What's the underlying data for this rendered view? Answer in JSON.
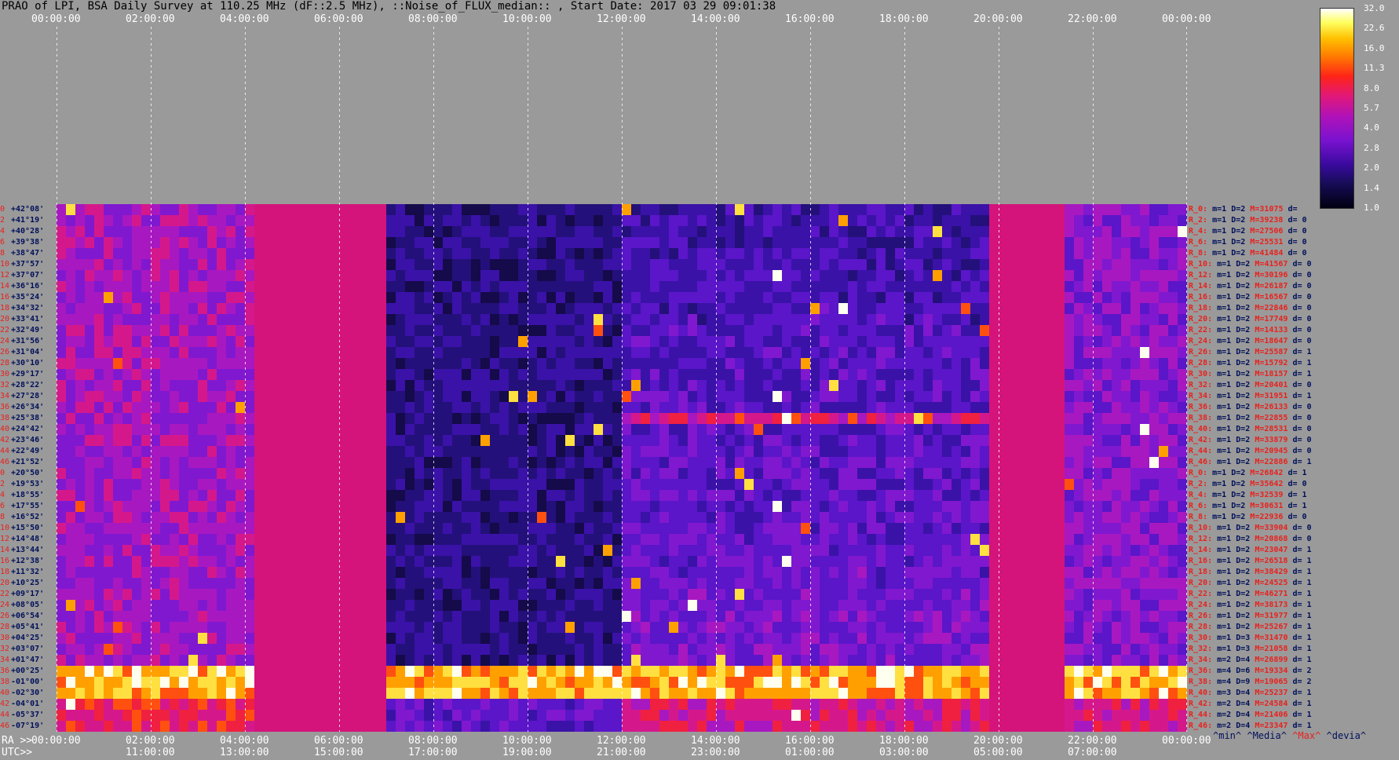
{
  "chart_data": {
    "type": "heatmap",
    "title": "PRAO of LPI, BSA Daily Survey at 110.25 MHz (dF::2.5 MHz), ::Noise_of_FLUX_median:: , Start Date: 2017 03 29 09:01:38",
    "top_ticks": [
      "00:00:00",
      "02:00:00",
      "04:00:00",
      "06:00:00",
      "08:00:00",
      "10:00:00",
      "12:00:00",
      "14:00:00",
      "16:00:00",
      "18:00:00",
      "20:00:00",
      "22:00:00",
      "00:00:00"
    ],
    "bottom_ra_label": "RA >>",
    "bottom_ra_ticks": [
      "00:00:00",
      "02:00:00",
      "04:00:00",
      "06:00:00",
      "08:00:00",
      "10:00:00",
      "12:00:00",
      "14:00:00",
      "16:00:00",
      "18:00:00",
      "20:00:00",
      "22:00:00",
      "00:00:00"
    ],
    "bottom_utc_label": "UTC>>",
    "bottom_utc_ticks": [
      "11:00:00",
      "13:00:00",
      "15:00:00",
      "17:00:00",
      "19:00:00",
      "21:00:00",
      "23:00:00",
      "01:00:00",
      "03:00:00",
      "05:00:00",
      "07:00:00"
    ],
    "colorbar_ticks": [
      "32.0",
      "22.6",
      "16.0",
      "11.3",
      "8.0",
      "5.7",
      "4.0",
      "2.8",
      "2.0",
      "1.4",
      "1.0"
    ],
    "declinations": [
      "+42°08'",
      "+41°19'",
      "+40°28'",
      "+39°38'",
      "+38°47'",
      "+37°57'",
      "+37°07'",
      "+36°16'",
      "+35°24'",
      "+34°32'",
      "+33°41'",
      "+32°49'",
      "+31°56'",
      "+31°04'",
      "+30°10'",
      "+29°17'",
      "+28°22'",
      "+27°28'",
      "+26°34'",
      "+25°38'",
      "+24°42'",
      "+23°46'",
      "+22°49'",
      "+21°52'",
      "+20°50'",
      "+19°53'",
      "+18°55'",
      "+17°55'",
      "+16°52'",
      "+15°50'",
      "+14°48'",
      "+13°44'",
      "+12°38'",
      "+11°32'",
      "+10°25'",
      "+09°17'",
      "+08°05'",
      "+06°54'",
      "+05°41'",
      "+04°25'",
      "+03°07'",
      "+01°47'",
      "+00°25'",
      "-01°00'",
      "-02°30'",
      "-04°01'",
      "-05°37'",
      "-07°19'"
    ],
    "beam_index": [
      "0",
      "2",
      "4",
      "6",
      "8",
      "10",
      "12",
      "14",
      "16",
      "18",
      "20",
      "22",
      "24",
      "26",
      "28",
      "30",
      "32",
      "34",
      "36",
      "38",
      "40",
      "42",
      "44",
      "46",
      "0",
      "2",
      "4",
      "6",
      "8",
      "10",
      "12",
      "14",
      "16",
      "18",
      "20",
      "22",
      "24",
      "26",
      "28",
      "30",
      "32",
      "34",
      "36",
      "38",
      "40",
      "42",
      "44",
      "46"
    ],
    "row_stats": [
      [
        "R_0:",
        "m=1",
        "D=2",
        "M=31075",
        "d= "
      ],
      [
        "R_2:",
        "m=1",
        "D=2",
        "M=39238",
        "d= 0"
      ],
      [
        "R_4:",
        "m=1",
        "D=2",
        "M=27506",
        "d= 0"
      ],
      [
        "R_6:",
        "m=1",
        "D=2",
        "M=25531",
        "d= 0"
      ],
      [
        "R_8:",
        "m=1",
        "D=2",
        "M=41484",
        "d= 0"
      ],
      [
        "R_10:",
        "m=1",
        "D=2",
        "M=41567",
        "d= 0"
      ],
      [
        "R_12:",
        "m=1",
        "D=2",
        "M=30196",
        "d= 0"
      ],
      [
        "R_14:",
        "m=1",
        "D=2",
        "M=26187",
        "d= 0"
      ],
      [
        "R_16:",
        "m=1",
        "D=2",
        "M=16567",
        "d= 0"
      ],
      [
        "R_18:",
        "m=1",
        "D=2",
        "M=22846",
        "d= 0"
      ],
      [
        "R_20:",
        "m=1",
        "D=2",
        "M=17749",
        "d= 0"
      ],
      [
        "R_22:",
        "m=1",
        "D=2",
        "M=14133",
        "d= 0"
      ],
      [
        "R_24:",
        "m=1",
        "D=2",
        "M=18647",
        "d= 0"
      ],
      [
        "R_26:",
        "m=1",
        "D=2",
        "M=25587",
        "d= 1"
      ],
      [
        "R_28:",
        "m=1",
        "D=2",
        "M=15792",
        "d= 1"
      ],
      [
        "R_30:",
        "m=1",
        "D=2",
        "M=18157",
        "d= 1"
      ],
      [
        "R_32:",
        "m=1",
        "D=2",
        "M=20401",
        "d= 0"
      ],
      [
        "R_34:",
        "m=1",
        "D=2",
        "M=31951",
        "d= 1"
      ],
      [
        "R_36:",
        "m=1",
        "D=2",
        "M=26133",
        "d= 0"
      ],
      [
        "R_38:",
        "m=1",
        "D=2",
        "M=22855",
        "d= 0"
      ],
      [
        "R_40:",
        "m=1",
        "D=2",
        "M=28531",
        "d= 0"
      ],
      [
        "R_42:",
        "m=1",
        "D=2",
        "M=33879",
        "d= 0"
      ],
      [
        "R_44:",
        "m=1",
        "D=2",
        "M=20945",
        "d= 0"
      ],
      [
        "R_46:",
        "m=1",
        "D=2",
        "M=22886",
        "d= 1"
      ],
      [
        "R_0:",
        "m=1",
        "D=2",
        "M=26842",
        "d= 1"
      ],
      [
        "R_2:",
        "m=1",
        "D=2",
        "M=35642",
        "d= 0"
      ],
      [
        "R_4:",
        "m=1",
        "D=2",
        "M=32539",
        "d= 1"
      ],
      [
        "R_6:",
        "m=1",
        "D=2",
        "M=30631",
        "d= 1"
      ],
      [
        "R_8:",
        "m=1",
        "D=2",
        "M=22936",
        "d= 0"
      ],
      [
        "R_10:",
        "m=1",
        "D=2",
        "M=33904",
        "d= 0"
      ],
      [
        "R_12:",
        "m=1",
        "D=2",
        "M=20868",
        "d= 0"
      ],
      [
        "R_14:",
        "m=1",
        "D=2",
        "M=23047",
        "d= 1"
      ],
      [
        "R_16:",
        "m=1",
        "D=2",
        "M=26518",
        "d= 1"
      ],
      [
        "R_18:",
        "m=1",
        "D=2",
        "M=38429",
        "d= 1"
      ],
      [
        "R_20:",
        "m=1",
        "D=2",
        "M=24525",
        "d= 1"
      ],
      [
        "R_22:",
        "m=1",
        "D=2",
        "M=46271",
        "d= 1"
      ],
      [
        "R_24:",
        "m=1",
        "D=2",
        "M=38173",
        "d= 1"
      ],
      [
        "R_26:",
        "m=1",
        "D=2",
        "M=31977",
        "d= 1"
      ],
      [
        "R_28:",
        "m=1",
        "D=2",
        "M=25267",
        "d= 1"
      ],
      [
        "R_30:",
        "m=1",
        "D=3",
        "M=31470",
        "d= 1"
      ],
      [
        "R_32:",
        "m=1",
        "D=3",
        "M=21058",
        "d= 1"
      ],
      [
        "R_34:",
        "m=2",
        "D=4",
        "M=26899",
        "d= 1"
      ],
      [
        "R_36:",
        "m=4",
        "D=6",
        "M=19334",
        "d= 2"
      ],
      [
        "R_38:",
        "m=4",
        "D=9",
        "M=19065",
        "d= 2"
      ],
      [
        "R_40:",
        "m=3",
        "D=4",
        "M=25237",
        "d= 1"
      ],
      [
        "R_42:",
        "m=2",
        "D=4",
        "M=24584",
        "d= 1"
      ],
      [
        "R_44:",
        "m=2",
        "D=4",
        "M=21406",
        "d= 1"
      ],
      [
        "R_46:",
        "m=2",
        "D=4",
        "M=23347",
        "d= 1"
      ]
    ],
    "legend": {
      "min": "^min^",
      "median": "^Media^",
      "max": "^Max^",
      "dev": "^devia^"
    },
    "masked_hour_ranges": [
      [
        4.2,
        7.0
      ],
      [
        19.8,
        21.4
      ]
    ],
    "bright_row_index": 42,
    "interference_row_index": 19,
    "colors": {
      "low": "#150a3a",
      "mask": "#d4147a",
      "hot": "#ffffc0"
    }
  }
}
